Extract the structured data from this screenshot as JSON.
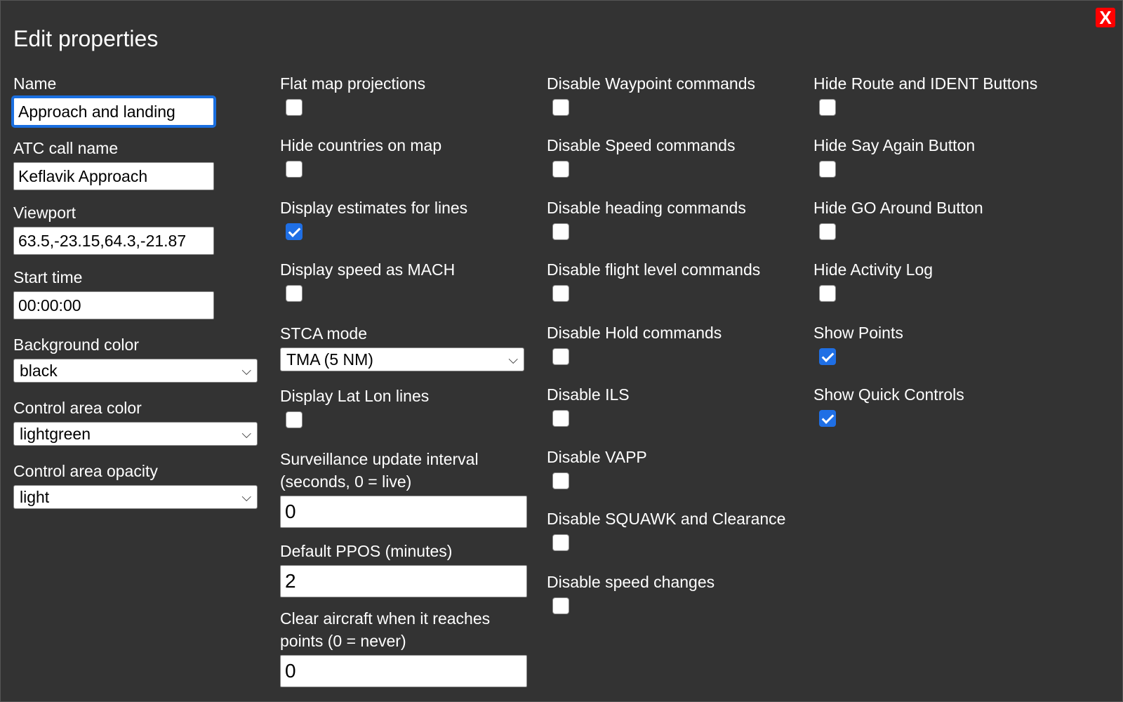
{
  "dialog": {
    "title": "Edit properties",
    "close_label": "X"
  },
  "col1": {
    "name": {
      "label": "Name",
      "value": "Approach and landing"
    },
    "atc_call_name": {
      "label": "ATC call name",
      "value": "Keflavik Approach"
    },
    "viewport": {
      "label": "Viewport",
      "value": "63.5,-23.15,64.3,-21.87"
    },
    "start_time": {
      "label": "Start time",
      "value": "00:00:00"
    },
    "background_color": {
      "label": "Background color",
      "value": "black"
    },
    "control_area_color": {
      "label": "Control area color",
      "value": "lightgreen"
    },
    "control_area_opacity": {
      "label": "Control area opacity",
      "value": "light"
    }
  },
  "col2": {
    "flat_map": {
      "label": "Flat map projections",
      "checked": false
    },
    "hide_countries": {
      "label": "Hide countries on map",
      "checked": false
    },
    "display_estimates": {
      "label": "Display estimates for lines",
      "checked": true
    },
    "speed_mach": {
      "label": "Display speed as MACH",
      "checked": false
    },
    "stca_mode": {
      "label": "STCA mode",
      "value": "TMA (5 NM)"
    },
    "lat_lon": {
      "label": "Display Lat Lon lines",
      "checked": false
    },
    "surveillance": {
      "label": "Surveillance update interval (seconds, 0 = live)",
      "value": "0"
    },
    "ppos": {
      "label": "Default PPOS (minutes)",
      "value": "2"
    },
    "clear_aircraft": {
      "label": "Clear aircraft when it reaches points (0 = never)",
      "value": "0"
    }
  },
  "col3": [
    {
      "label": "Disable Waypoint commands",
      "checked": false
    },
    {
      "label": "Disable Speed commands",
      "checked": false
    },
    {
      "label": "Disable heading commands",
      "checked": false
    },
    {
      "label": "Disable flight level commands",
      "checked": false
    },
    {
      "label": "Disable Hold commands",
      "checked": false
    },
    {
      "label": "Disable ILS",
      "checked": false
    },
    {
      "label": "Disable VAPP",
      "checked": false
    },
    {
      "label": "Disable SQUAWK and Clearance",
      "checked": false
    },
    {
      "label": "Disable speed changes",
      "checked": false
    }
  ],
  "col4": [
    {
      "label": "Hide Route and IDENT Buttons",
      "checked": false
    },
    {
      "label": "Hide Say Again Button",
      "checked": false
    },
    {
      "label": "Hide GO Around Button",
      "checked": false
    },
    {
      "label": "Hide Activity Log",
      "checked": false
    },
    {
      "label": "Show Points",
      "checked": true
    },
    {
      "label": "Show Quick Controls",
      "checked": true
    }
  ],
  "colors": {
    "background": "#333333",
    "accent": "#1f6fe5",
    "close": "#ff0000"
  }
}
